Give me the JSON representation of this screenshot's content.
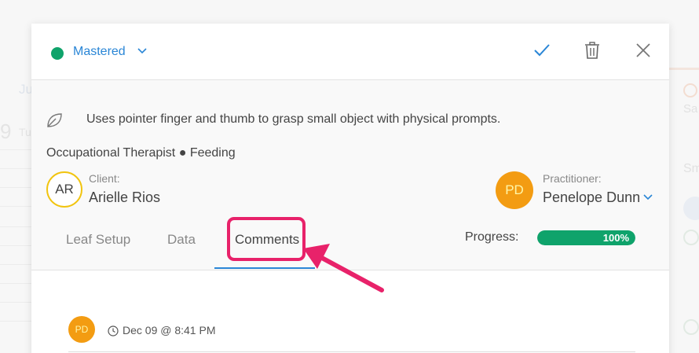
{
  "header": {
    "status_label": "Mastered",
    "status_color": "#0fa36b",
    "icons": [
      "check-icon",
      "trash-icon",
      "close-icon"
    ]
  },
  "goal": {
    "description": "Uses pointer finger and thumb to grasp small object with physical prompts.",
    "discipline": "Occupational Therapist",
    "separator": "●",
    "category": "Feeding"
  },
  "client": {
    "role_label": "Client:",
    "initials": "AR",
    "name": "Arielle Rios"
  },
  "practitioner": {
    "role_label": "Practitioner:",
    "initials": "PD",
    "name": "Penelope Dunn"
  },
  "tabs": [
    {
      "label": "Leaf Setup"
    },
    {
      "label": "Data"
    },
    {
      "label": "Comments",
      "active": true
    }
  ],
  "progress": {
    "label": "Progress:",
    "value_text": "100%",
    "fraction": 1.0,
    "color": "#0fa36b"
  },
  "comments": [
    {
      "initials": "PD",
      "timestamp": "Dec 09 @ 8:41 PM"
    }
  ],
  "background": {
    "left_text1": "Ju",
    "left_text2": "9",
    "left_text3": "Tu",
    "right_text1": "Sa",
    "right_text2": "Sm"
  },
  "annotation": {
    "color": "#e8226a"
  }
}
